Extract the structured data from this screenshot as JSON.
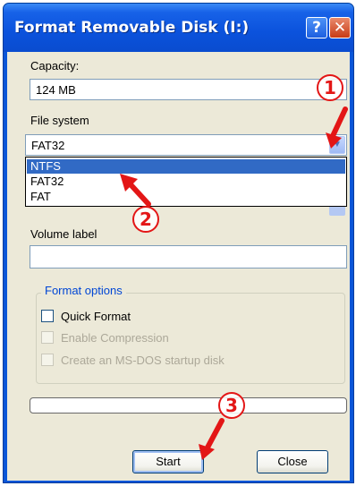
{
  "window": {
    "title": "Format Removable Disk (I:)",
    "help_glyph": "?",
    "close_glyph": "✕"
  },
  "capacity": {
    "label": "Capacity:",
    "value": "124 MB"
  },
  "file_system": {
    "label": "File system",
    "selected": "FAT32",
    "arrow_glyph": "▼",
    "options": [
      "NTFS",
      "FAT32",
      "FAT"
    ],
    "highlighted_option": "NTFS"
  },
  "volume_label": {
    "label": "Volume label",
    "value": ""
  },
  "format_options": {
    "title": "Format options",
    "quick_format": "Quick Format",
    "enable_compression": "Enable Compression",
    "ms_dos_startup": "Create an MS-DOS startup disk"
  },
  "progress": {
    "value": 0
  },
  "buttons": {
    "start": "Start",
    "close": "Close"
  },
  "annotations": [
    "1",
    "2",
    "3"
  ],
  "colors": {
    "titlebar": "#0a52dc",
    "dialog_bg": "#ece9d8",
    "selection": "#316ac5",
    "annotation": "#e31616",
    "group_title": "#0046d5"
  },
  "icons": {
    "help": "help-icon",
    "close": "close-icon",
    "dropdown": "chevron-down-icon",
    "pointer": "red-arrow-icon"
  }
}
